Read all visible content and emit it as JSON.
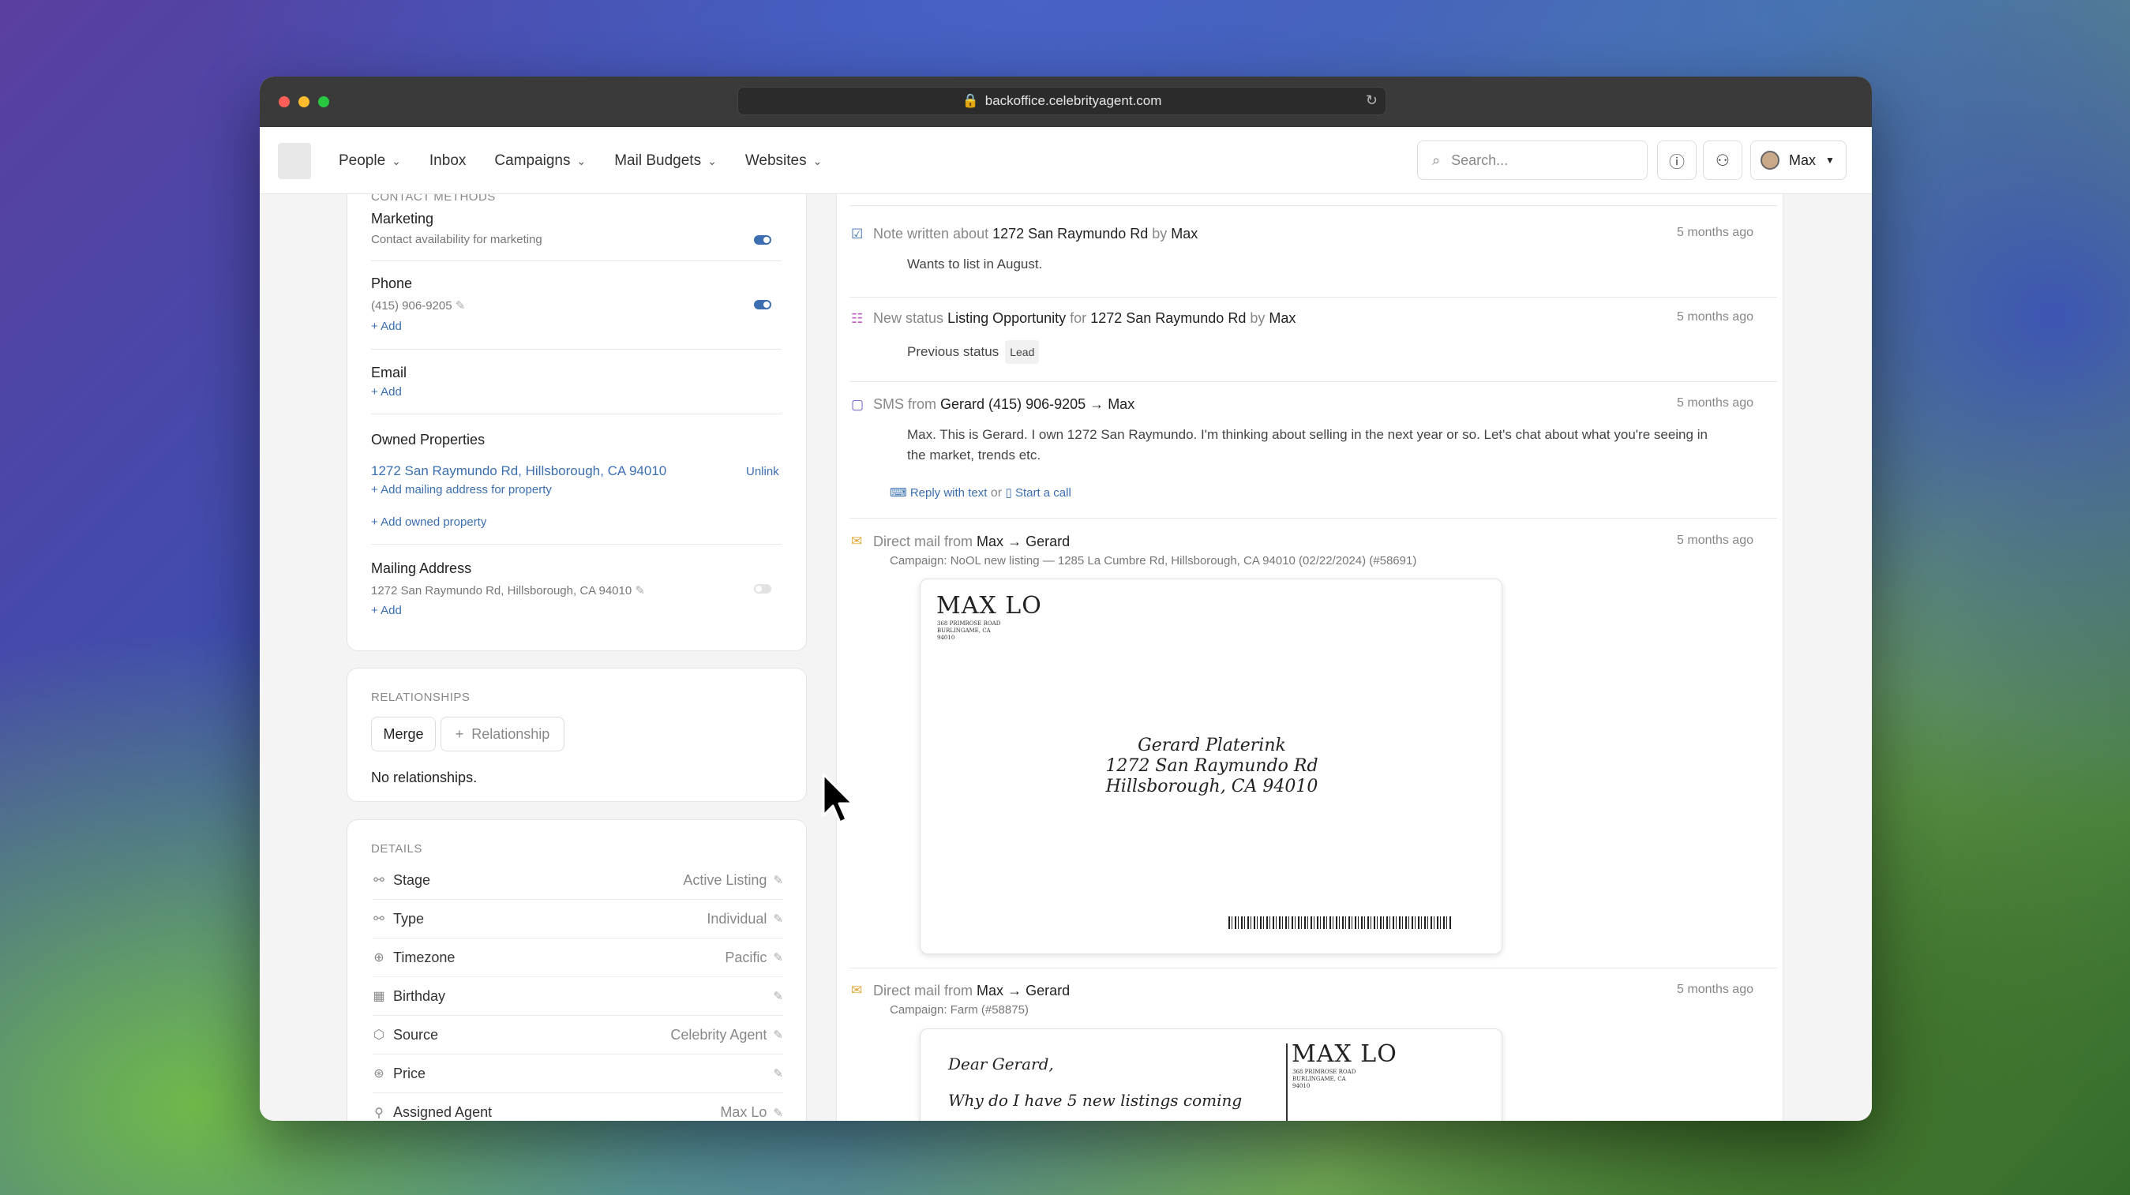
{
  "browser": {
    "url": "backoffice.celebrityagent.com"
  },
  "nav": {
    "items": [
      "People",
      "Inbox",
      "Campaigns",
      "Mail Budgets",
      "Websites"
    ],
    "search_placeholder": "Search...",
    "user": "Max"
  },
  "contact": {
    "section": "CONTACT METHODS",
    "marketing": {
      "label": "Marketing",
      "sub": "Contact availability for marketing",
      "enabled": true
    },
    "phone": {
      "label": "Phone",
      "value": "(415) 906-9205",
      "add": "+ Add",
      "enabled": true
    },
    "email": {
      "label": "Email",
      "add": "+ Add"
    },
    "owned": {
      "label": "Owned Properties",
      "address": "1272 San Raymundo Rd, Hillsborough, CA 94010",
      "unlink": "Unlink",
      "add_mailing": "+ Add mailing address for property",
      "add_owned": "+ Add owned property"
    },
    "mailing": {
      "label": "Mailing Address",
      "value": "1272 San Raymundo Rd, Hillsborough, CA 94010",
      "add": "+ Add",
      "enabled": false
    }
  },
  "relationships": {
    "section": "RELATIONSHIPS",
    "merge": "Merge",
    "add": "Relationship",
    "empty": "No relationships."
  },
  "details": {
    "section": "DETAILS",
    "rows": [
      {
        "key": "Stage",
        "value": "Active Listing",
        "icon": "stage-icon"
      },
      {
        "key": "Type",
        "value": "Individual",
        "icon": "type-icon"
      },
      {
        "key": "Timezone",
        "value": "Pacific",
        "icon": "globe-icon"
      },
      {
        "key": "Birthday",
        "value": "",
        "icon": "calendar-icon"
      },
      {
        "key": "Source",
        "value": "Celebrity Agent",
        "icon": "box-icon"
      },
      {
        "key": "Price",
        "value": "",
        "icon": "dollar-icon"
      },
      {
        "key": "Assigned Agent",
        "value": "Max Lo",
        "icon": "person-icon"
      }
    ]
  },
  "feed": {
    "note": {
      "pre": "Note written about",
      "prop": "1272 San Raymundo Rd",
      "by": "by",
      "who": "Max",
      "time": "5 months ago",
      "body": "Wants to list in August."
    },
    "status": {
      "pre": "New status",
      "status": "Listing Opportunity",
      "for": "for",
      "prop": "1272 San Raymundo Rd",
      "by": "by",
      "who": "Max",
      "time": "5 months ago",
      "prev": "Previous status",
      "prev_tag": "Lead"
    },
    "sms": {
      "pre": "SMS from",
      "from": "Gerard (415) 906-9205",
      "to": "Max",
      "time": "5 months ago",
      "body": "Max. This is Gerard. I own 1272 San Raymundo. I'm thinking about selling in the next year or so. Let's chat about what you're seeing in the market, trends etc.",
      "reply": "Reply with text",
      "or": "or",
      "call": "Start a call"
    },
    "mail1": {
      "pre": "Direct mail from",
      "from": "Max",
      "to": "Gerard",
      "time": "5 months ago",
      "campaign": "Campaign: NoOL new listing — 1285 La Cumbre Rd, Hillsborough, CA 94010 (02/22/2024) (#58691)",
      "sender_name": "MAX LO",
      "sender_addr": [
        "368 PRIMROSE ROAD",
        "BURLINGAME, CA",
        "94010"
      ],
      "recipient": [
        "Gerard Platerink",
        "1272 San Raymundo Rd",
        "Hillsborough, CA 94010"
      ]
    },
    "mail2": {
      "pre": "Direct mail from",
      "from": "Max",
      "to": "Gerard",
      "time": "5 months ago",
      "campaign": "Campaign: Farm (#58875)",
      "greeting": "Dear Gerard,",
      "line": "Why do I have 5 new listings coming",
      "sender_name": "MAX LO",
      "sender_addr": [
        "368 PRIMROSE ROAD",
        "BURLINGAME, CA",
        "94010"
      ]
    }
  }
}
